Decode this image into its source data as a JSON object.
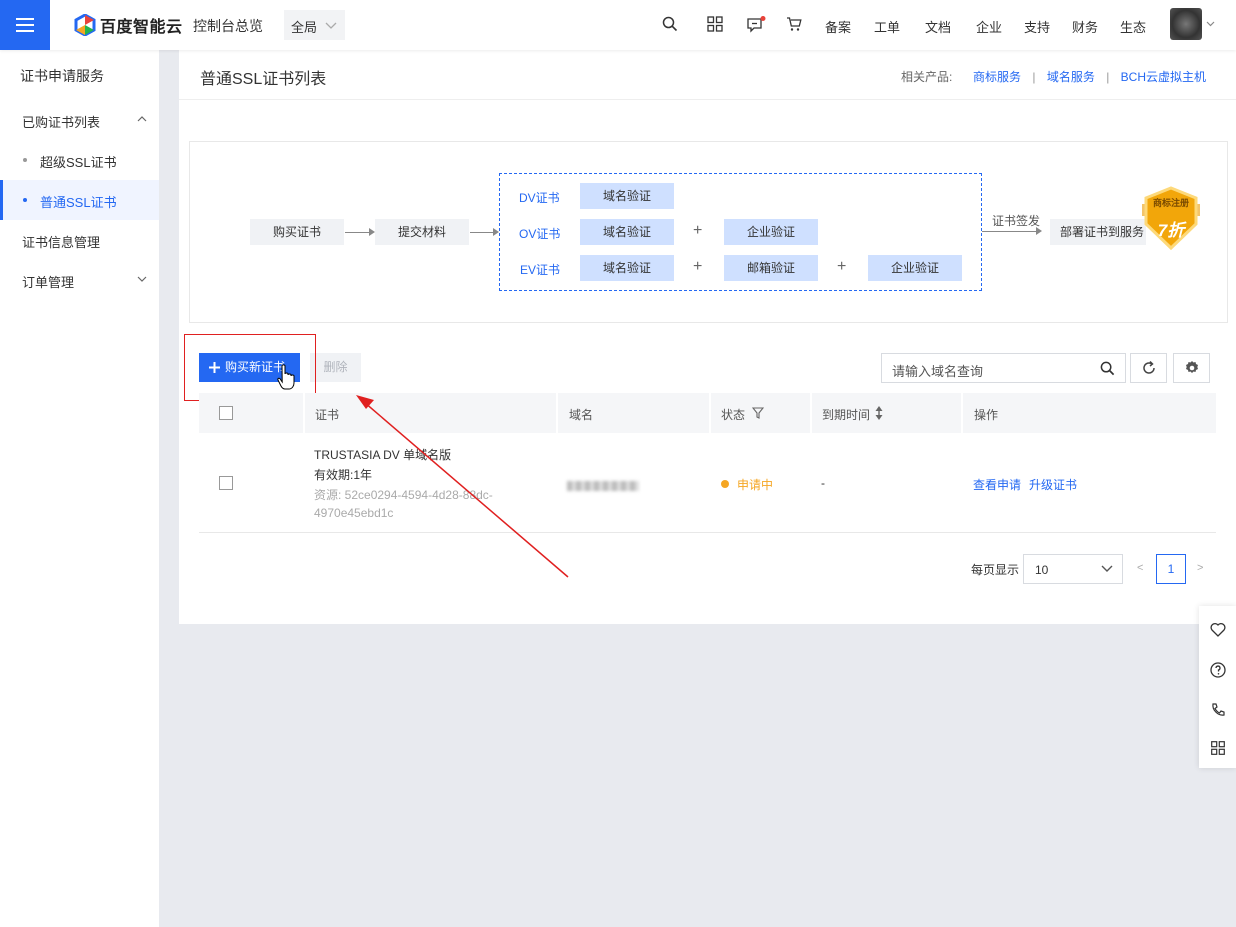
{
  "topbar": {
    "logo_text": "百度智能云",
    "console_label": "控制台总览",
    "region_label": "全局",
    "nav": [
      "备案",
      "工单",
      "文档",
      "企业",
      "支持",
      "财务",
      "生态"
    ]
  },
  "sidebar": {
    "title": "证书申请服务",
    "items": [
      {
        "label": "已购证书列表"
      },
      {
        "label": "超级SSL证书"
      },
      {
        "label": "普通SSL证书"
      },
      {
        "label": "证书信息管理"
      },
      {
        "label": "订单管理"
      }
    ]
  },
  "header": {
    "title": "普通SSL证书列表",
    "related_label": "相关产品:",
    "related_links": [
      "商标服务",
      "域名服务",
      "BCH云虚拟主机"
    ]
  },
  "flow": {
    "buy": "购买证书",
    "submit": "提交材料",
    "dv_label": "DV证书",
    "ov_label": "OV证书",
    "ev_label": "EV证书",
    "domain_verify": "域名验证",
    "company_verify": "企业验证",
    "email_verify": "邮箱验证",
    "plus": "+",
    "issue_label": "证书签发",
    "deploy": "部署证书到服务",
    "badge_line1": "商标注册",
    "badge_line2": "7折"
  },
  "toolbar": {
    "buy_label": "购买新证书",
    "delete_label": "删除",
    "search_placeholder": "请输入域名查询"
  },
  "table": {
    "columns": [
      "证书",
      "域名",
      "状态",
      "到期时间",
      "操作"
    ],
    "rows": [
      {
        "cert_name": "TRUSTASIA DV 单域名版",
        "validity": "有效期:1年",
        "resource_1": "资源: 52ce0294-4594-4d28-88dc-",
        "resource_2": "4970e45ebd1c",
        "status": "申请中",
        "expiry": "-",
        "action_view": "查看申请",
        "action_upgrade": "升级证书"
      }
    ]
  },
  "pagination": {
    "per_page_label": "每页显示",
    "per_page_value": "10",
    "prev": "<",
    "current": "1",
    "next": ">"
  },
  "colors": {
    "primary": "#2468f2",
    "status_pending": "#f5a623",
    "annotation_red": "#e02020"
  }
}
